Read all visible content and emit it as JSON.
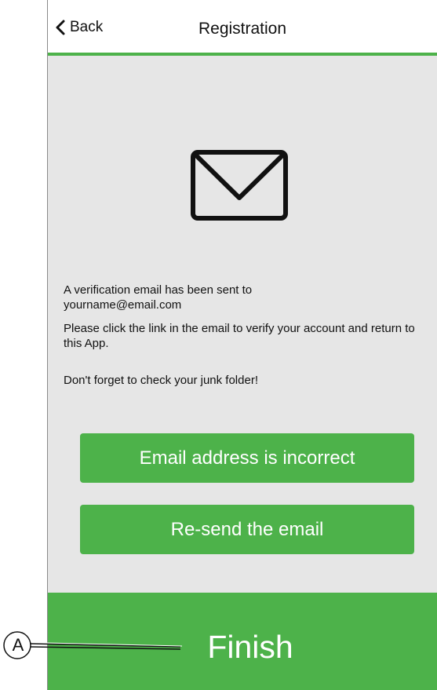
{
  "header": {
    "back_label": "Back",
    "title": "Registration"
  },
  "main": {
    "envelope_icon": "envelope-icon",
    "message_line1": "A verification email has been sent to",
    "email": "yourname@email.com",
    "message_instructions": "Please click the link in the email to verify your account and return to this App.",
    "message_junk": "Don't forget to check your junk folder!",
    "incorrect_button": "Email address is incorrect",
    "resend_button": "Re-send the email"
  },
  "footer": {
    "finish_label": "Finish"
  },
  "callout": {
    "label": "A"
  },
  "colors": {
    "accent": "#4db24a",
    "background": "#e6e6e6",
    "header_bg": "#ffffff",
    "text": "#111111"
  }
}
